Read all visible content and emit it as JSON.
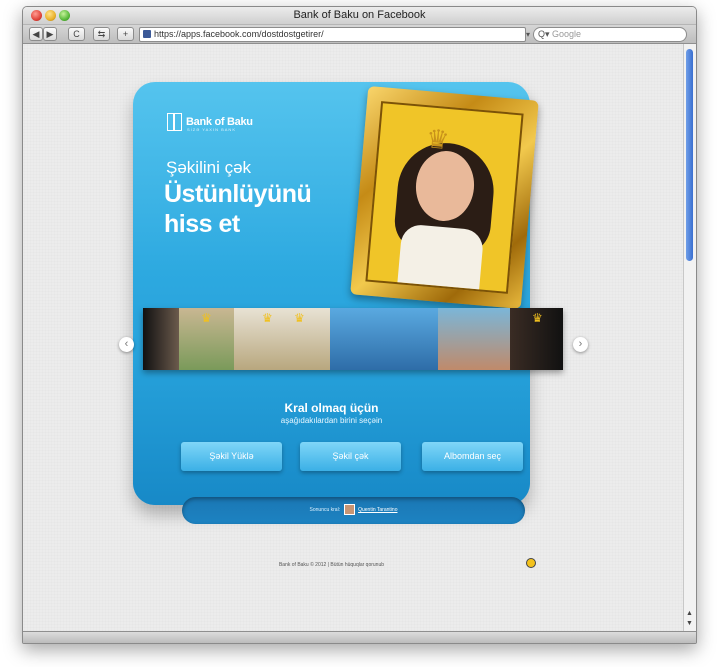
{
  "window": {
    "title": "Bank of Baku on Facebook"
  },
  "toolbar": {
    "back_label": "◀",
    "forward_label": "▶",
    "reload_label": "C",
    "snapback_label": "⇆",
    "add_label": "+",
    "url": "https://apps.facebook.com/dostdostgetirer/",
    "search_placeholder": "Google"
  },
  "app": {
    "logo_text": "Bank of Baku",
    "logo_tagline": "SİZƏ YAXIN BANK",
    "subheading": "Şəkilini çək",
    "headline_line1": "Üstünlüyünü",
    "headline_line2": "hiss et",
    "cta_title": "Kral olmaq üçün",
    "cta_subtitle": "aşağıdakılardan birini seçəin",
    "buttons": {
      "upload": "Şəkil Yüklə",
      "take": "Şəkil çək",
      "album": "Albomdan seç"
    },
    "last_king_label": "Sonuncu kral:",
    "last_king_name": "Quentin Tarantino",
    "footer": "Bank of Baku © 2012 | Bütün hüquqlar qorunub"
  },
  "colors": {
    "card_top": "#55c4ee",
    "card_bottom": "#1789c7",
    "frame_gold": "#c58b16",
    "button": "#3bb0e6"
  }
}
